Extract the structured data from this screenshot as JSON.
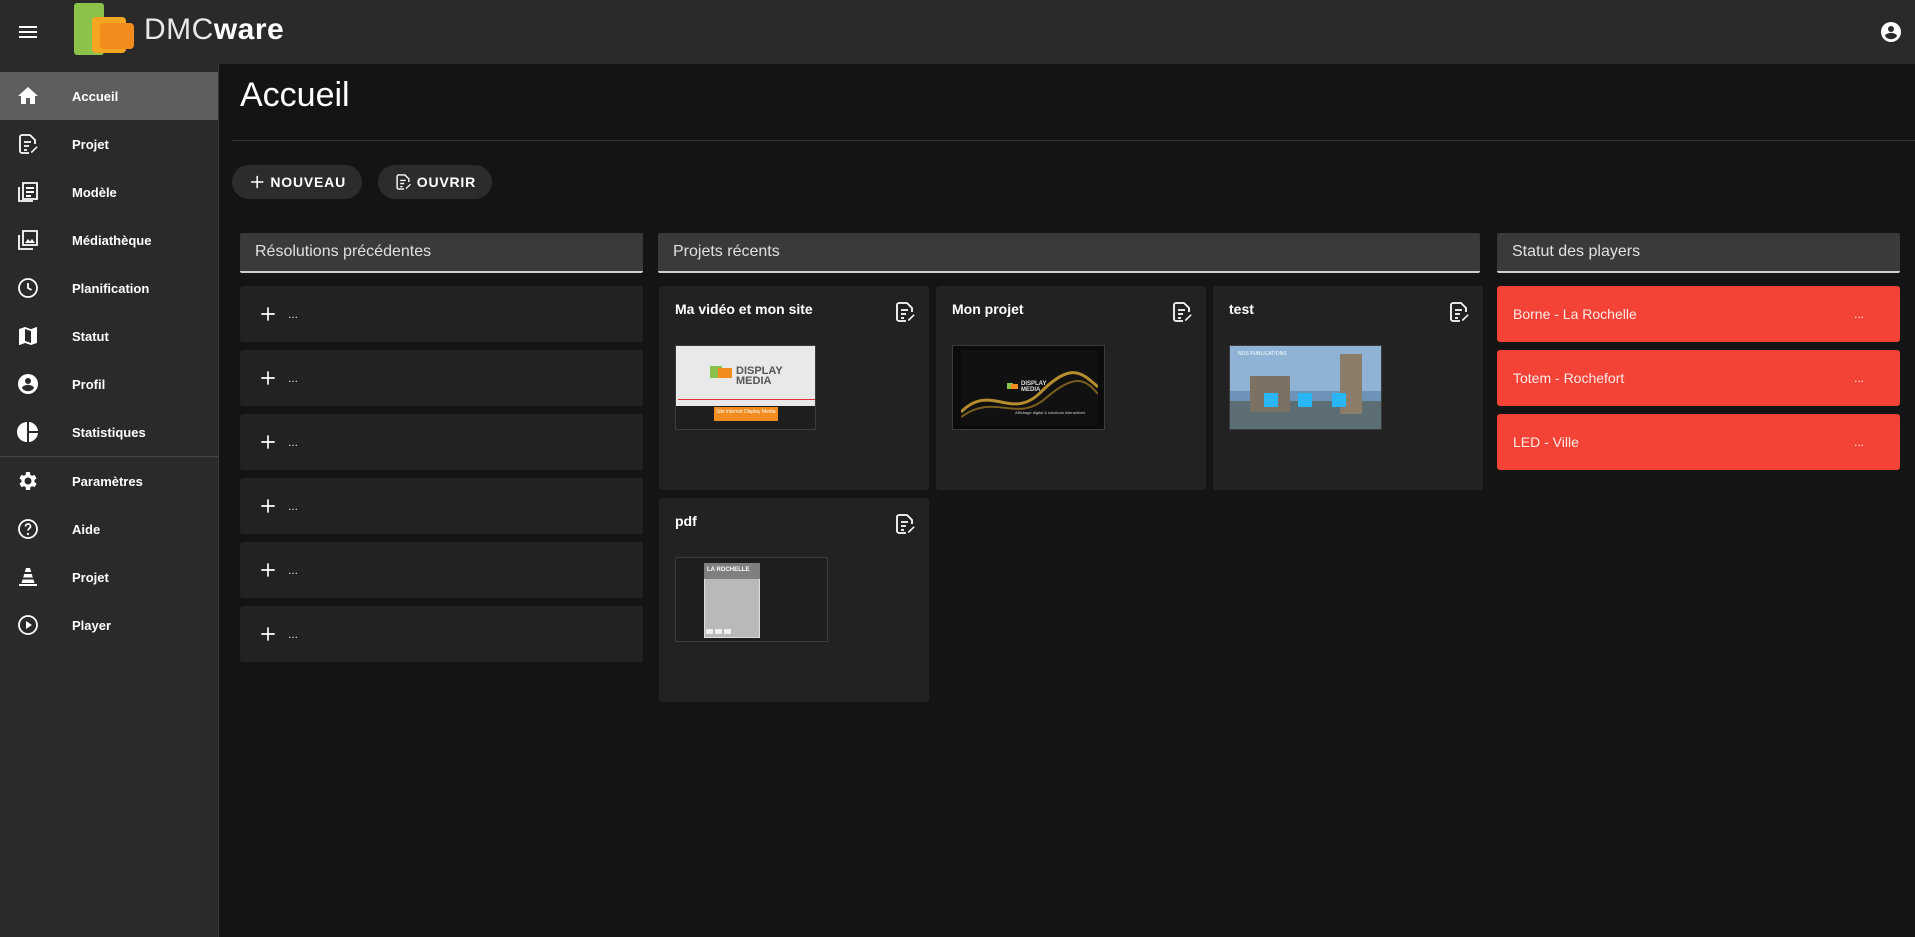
{
  "app": {
    "logo_dmc": "DMC",
    "logo_ware": "ware"
  },
  "sidebar": {
    "items": [
      {
        "label": "Accueil",
        "icon": "home-icon"
      },
      {
        "label": "Projet",
        "icon": "file-edit-icon"
      },
      {
        "label": "Modèle",
        "icon": "template-icon"
      },
      {
        "label": "Médiathèque",
        "icon": "image-library-icon"
      },
      {
        "label": "Planification",
        "icon": "clock-icon"
      },
      {
        "label": "Statut",
        "icon": "map-icon"
      },
      {
        "label": "Profil",
        "icon": "account-circle-icon"
      },
      {
        "label": "Statistiques",
        "icon": "pie-chart-icon"
      },
      {
        "label": "Paramètres",
        "icon": "gear-icon"
      },
      {
        "label": "Aide",
        "icon": "help-icon"
      },
      {
        "label": "Projet",
        "icon": "cone-icon"
      },
      {
        "label": "Player",
        "icon": "play-circle-icon"
      }
    ]
  },
  "main": {
    "title": "Accueil",
    "new_label": "NOUVEAU",
    "open_label": "OUVRIR"
  },
  "resolutions": {
    "header": "Résolutions précédentes",
    "items": [
      "...",
      "...",
      "...",
      "...",
      "...",
      "..."
    ]
  },
  "projects": {
    "header": "Projets récents",
    "items": [
      {
        "title": "Ma vidéo et mon site",
        "thumb_text": "DISPLAY MEDIA",
        "thumb_sub": "Site internet Display Media"
      },
      {
        "title": "Mon projet",
        "thumb_text": "DISPLAY MEDIA",
        "thumb_sub": "Affichage digital & solutions interactives"
      },
      {
        "title": "test",
        "thumb_text": "NOS PUBLICATIONS"
      },
      {
        "title": "pdf",
        "thumb_text": "LA ROCHELLE"
      }
    ]
  },
  "players": {
    "header": "Statut des players",
    "items": [
      {
        "name": "Borne - La Rochelle",
        "value": "..."
      },
      {
        "name": "Totem - Rochefort",
        "value": "..."
      },
      {
        "name": "LED - Ville",
        "value": "..."
      }
    ],
    "status_color": "#f44336"
  }
}
